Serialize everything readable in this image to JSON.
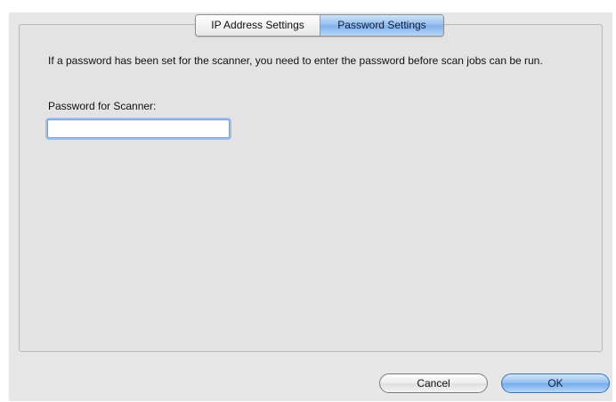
{
  "tabs": [
    {
      "label": "IP Address Settings",
      "active": false
    },
    {
      "label": "Password Settings",
      "active": true
    }
  ],
  "content": {
    "description": "If a password has been set for the scanner, you need to enter the password before scan jobs can be run.",
    "password_label": "Password for Scanner:",
    "password_value": ""
  },
  "buttons": {
    "cancel": "Cancel",
    "ok": "OK"
  },
  "colors": {
    "accent": "#8fbcef",
    "panel_background": "#e3e3e3"
  }
}
